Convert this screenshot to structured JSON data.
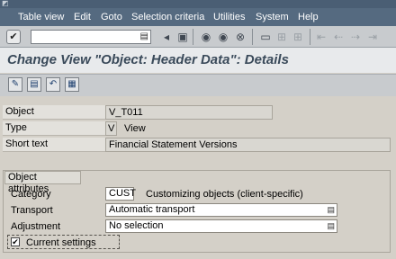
{
  "menu": [
    "Table view",
    "Edit",
    "Goto",
    "Selection criteria",
    "Utilities",
    "System",
    "Help"
  ],
  "title": "Change View \"Object: Header Data\": Details",
  "header": {
    "object_label": "Object",
    "object_value": "V_T011",
    "type_label": "Type",
    "type_code": "V",
    "type_text": "View",
    "short_text_label": "Short text",
    "short_text_value": "Financial Statement Versions"
  },
  "attributes": {
    "group_title": "Object attributes",
    "category_label": "Category",
    "category_value": "CUST",
    "category_text": "Customizing objects (client-specific)",
    "transport_label": "Transport",
    "transport_value": "Automatic transport",
    "adjustment_label": "Adjustment",
    "adjustment_value": "No selection",
    "current_settings_label": "Current settings",
    "current_settings_checked": true
  },
  "icons": {
    "ok": "check-icon",
    "back": "back-icon",
    "exit": "exit-icon",
    "cancel": "cancel-icon",
    "print": "print-icon",
    "find": "find-icon",
    "find_next": "find-next-icon"
  },
  "colors": {
    "menubar": "#556a80",
    "title": "#3a4a5a",
    "content": "#d4d0c8"
  }
}
